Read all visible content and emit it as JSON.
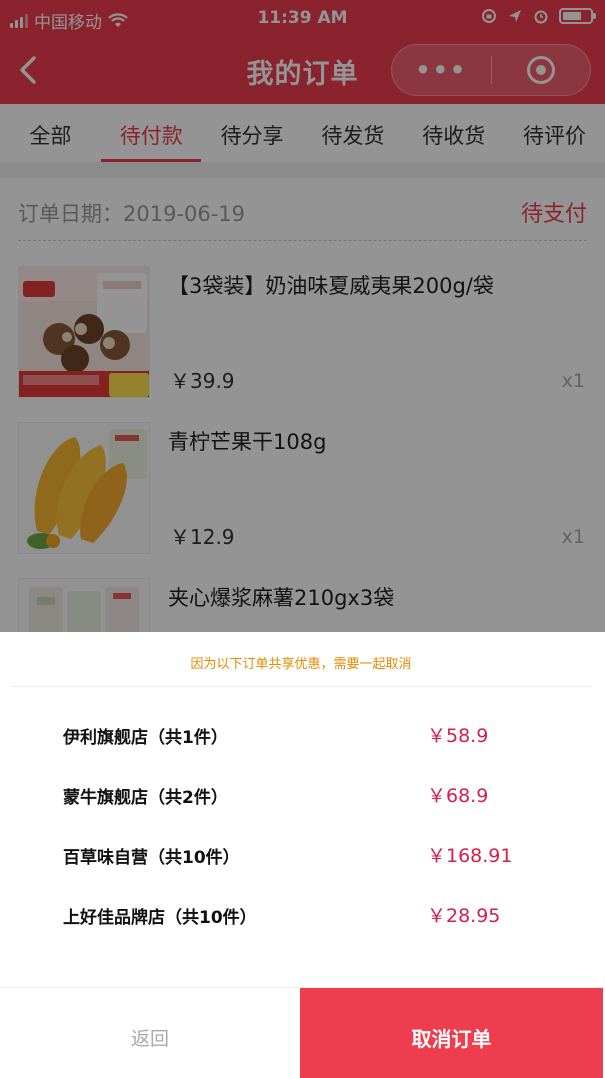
{
  "status_bar": {
    "carrier": "中国移动",
    "time": "11:39 AM"
  },
  "nav": {
    "title": "我的订单",
    "more_glyph": "•••"
  },
  "tabs": [
    {
      "label": "全部"
    },
    {
      "label": "待付款",
      "active": true
    },
    {
      "label": "待分享"
    },
    {
      "label": "待发货"
    },
    {
      "label": "待收货"
    },
    {
      "label": "待评价"
    }
  ],
  "order": {
    "date_label": "订单日期：2019-06-19",
    "status": "待支付",
    "items": [
      {
        "name": "【3袋装】奶油味夏威夷果200g/袋",
        "price": "￥39.9",
        "qty": "x1",
        "thumb": "macadamia-nuts-product-image"
      },
      {
        "name": "青柠芒果干108g",
        "price": "￥12.9",
        "qty": "x1",
        "thumb": "dried-mango-product-image"
      },
      {
        "name": "夹心爆浆麻薯210gx3袋",
        "price": "",
        "qty": "",
        "thumb": "mochi-product-image"
      }
    ]
  },
  "sheet": {
    "notice": "因为以下订单共享优惠，需要一起取消",
    "shops": [
      {
        "name": "伊利旗舰店（共1件）",
        "price": "￥58.9"
      },
      {
        "name": "蒙牛旗舰店（共2件）",
        "price": "￥68.9"
      },
      {
        "name": "百草味自营（共10件）",
        "price": "￥168.91"
      },
      {
        "name": "上好佳品牌店（共10件）",
        "price": "￥28.95"
      }
    ],
    "back_label": "返回",
    "cancel_label": "取消订单"
  },
  "colors": {
    "brand_red": "#ee3d4e",
    "price_red": "#d81e4a",
    "notice_orange": "#e68a00"
  }
}
